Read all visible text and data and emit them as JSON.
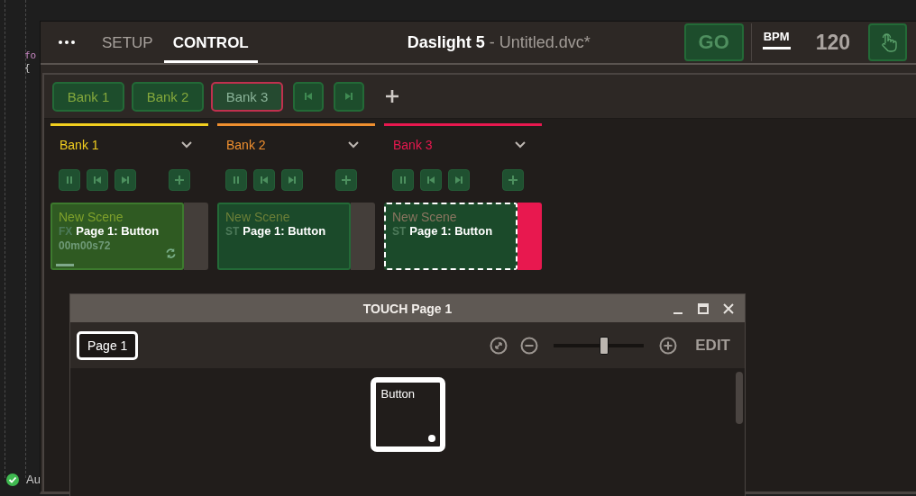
{
  "editor": {
    "lines": [
      "fo",
      "{"
    ],
    "status": "Au"
  },
  "header": {
    "tabs": [
      {
        "label": "SETUP",
        "selected": false
      },
      {
        "label": "CONTROL",
        "selected": true
      }
    ],
    "title": "Daslight 5",
    "file": "- Untitled.dvc*",
    "go": "GO",
    "bpm_label": "BPM",
    "bpm": "120"
  },
  "bank_tabs": [
    {
      "label": "Bank 1",
      "selected": false
    },
    {
      "label": "Bank 2",
      "selected": false
    },
    {
      "label": "Bank 3",
      "selected": true
    }
  ],
  "banks": [
    {
      "name": "Bank 1",
      "color": "#f2cf1f",
      "scene": {
        "name": "New Scene",
        "type": "FX",
        "overlay": "Page 1: Button",
        "time": "00m00s72",
        "playing": true,
        "selected": false,
        "level": 0.15
      }
    },
    {
      "name": "Bank 2",
      "color": "#ef8f2f",
      "scene": {
        "name": "New Scene",
        "type": "ST",
        "overlay": "Page 1: Button",
        "playing": false,
        "selected": false
      }
    },
    {
      "name": "Bank 3",
      "color": "#e8184f",
      "scene": {
        "name": "New Scene",
        "type": "ST",
        "overlay": "Page 1: Button",
        "playing": false,
        "selected": true
      }
    }
  ],
  "touch": {
    "title": "TOUCH Page 1",
    "page": "Page 1",
    "zoom": {
      "level": 0.56
    },
    "edit": "EDIT",
    "buttons": [
      {
        "label": "Button"
      }
    ]
  }
}
